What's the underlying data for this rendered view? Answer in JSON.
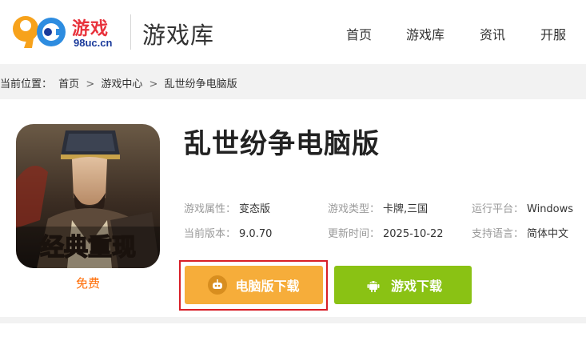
{
  "brand": {
    "logo_digits": "98",
    "logo_cn": "游戏",
    "logo_domain": "98uc.cn"
  },
  "header": {
    "section_title": "游戏库"
  },
  "nav": [
    "首页",
    "游戏库",
    "资讯",
    "开服"
  ],
  "breadcrumb": {
    "prefix": "当前位置：",
    "items": [
      "首页",
      "游戏中心",
      "乱世纷争电脑版"
    ],
    "separator": ">"
  },
  "game": {
    "title": "乱世纷争电脑版",
    "price": "免费",
    "icon_caption": "经典重现",
    "info": [
      {
        "key": "游戏属性：",
        "value": "变态版"
      },
      {
        "key": "游戏类型：",
        "value": "卡牌,三国"
      },
      {
        "key": "运行平台：",
        "value": "Windows"
      },
      {
        "key": "当前版本：",
        "value": "9.0.70"
      },
      {
        "key": "更新时间：",
        "value": "2025-10-22"
      },
      {
        "key": "支持语言：",
        "value": "简体中文"
      }
    ]
  },
  "buttons": {
    "pc_download": "电脑版下载",
    "game_download": "游戏下载"
  },
  "colors": {
    "brand_red": "#e8323c",
    "accent_orange": "#f6ad3a",
    "accent_green": "#8ac214",
    "price_orange": "#ff6a00",
    "highlight_red": "#d81e27"
  },
  "icons": {
    "pc_button": "gamepad-robot-icon",
    "game_button": "android-icon"
  }
}
